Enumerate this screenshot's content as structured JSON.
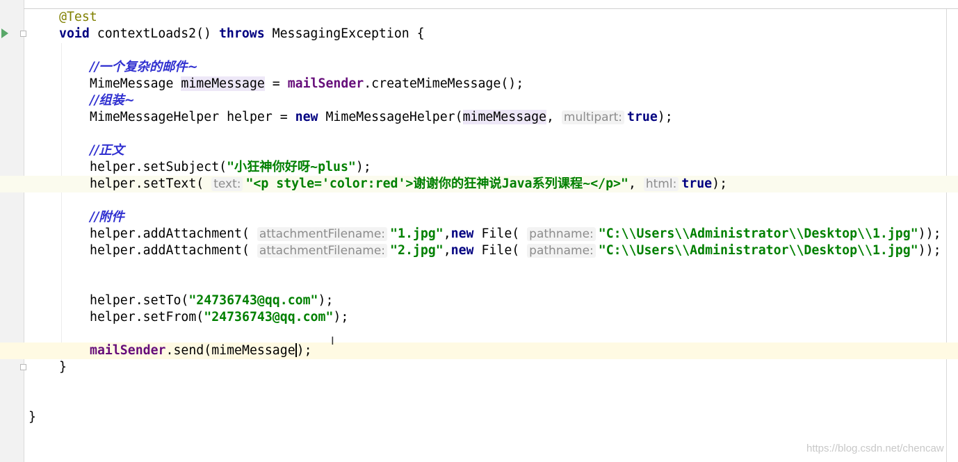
{
  "editor": {
    "lines": {
      "annotation": "@Test",
      "sig_void": "void",
      "sig_name": " contextLoads2() ",
      "sig_throws": "throws",
      "sig_rest": " MessagingException {",
      "c1": "//一个复杂的邮件~",
      "l_mime_type": "MimeMessage ",
      "l_mime_var": "mimeMessage",
      "l_mime_eq": " = ",
      "l_mime_sender": "mailSender",
      "l_mime_call": ".createMimeMessage();",
      "c2": "//组装~",
      "l_helper_a": "MimeMessageHelper helper = ",
      "l_helper_new": "new",
      "l_helper_b": " MimeMessageHelper(",
      "l_helper_arg": "mimeMessage",
      "l_helper_comma": ", ",
      "l_helper_hint": "multipart:",
      "l_helper_true": "true",
      "l_helper_end": ");",
      "c3": "//正文",
      "l_subject_a": "helper.setSubject(",
      "l_subject_str": "\"小狂神你好呀~plus\"",
      "l_subject_end": ");",
      "l_text_a": "helper.setText(",
      "l_text_hint": "text:",
      "l_text_str": "\"<p style='color:red'>谢谢你的狂神说Java系列课程~</p>\"",
      "l_text_comma": ", ",
      "l_text_hint2": "html:",
      "l_text_true": "true",
      "l_text_end": ");",
      "c4": "//附件",
      "l_att1_a": "helper.addAttachment(",
      "l_att1_hint": "attachmentFilename:",
      "l_att1_str": "\"1.jpg\"",
      "l_att1_comma": ",",
      "l_att1_new": "new",
      "l_att1_file": " File(",
      "l_att1_hint2": "pathname:",
      "l_att1_path": "\"C:\\\\Users\\\\Administrator\\\\Desktop\\\\1.jpg\"",
      "l_att1_end": "));",
      "l_att2_a": "helper.addAttachment(",
      "l_att2_hint": "attachmentFilename:",
      "l_att2_str": "\"2.jpg\"",
      "l_att2_comma": ",",
      "l_att2_new": "new",
      "l_att2_file": " File(",
      "l_att2_hint2": "pathname:",
      "l_att2_path": "\"C:\\\\Users\\\\Administrator\\\\Desktop\\\\1.jpg\"",
      "l_att2_end": "));",
      "l_to_a": "helper.setTo(",
      "l_to_str": "\"24736743@qq.com\"",
      "l_to_end": ");",
      "l_from_a": "helper.setFrom(",
      "l_from_str": "\"24736743@qq.com\"",
      "l_from_end": ");",
      "l_send_sender": "mailSender",
      "l_send_a": ".send(mimeMessage",
      "l_send_end": ");",
      "close_method": "}",
      "close_class": "}"
    },
    "cursor_icon": "text-cursor-icon",
    "run_icon": "run-test-icon",
    "fold_icon": "fold-icon"
  },
  "colors": {
    "keyword": "#000080",
    "string": "#008000",
    "comment": "#3030d0",
    "field": "#660e7a",
    "annotation": "#808000",
    "current_line": "#fffae3"
  },
  "watermark": "https://blog.csdn.net/chencaw"
}
